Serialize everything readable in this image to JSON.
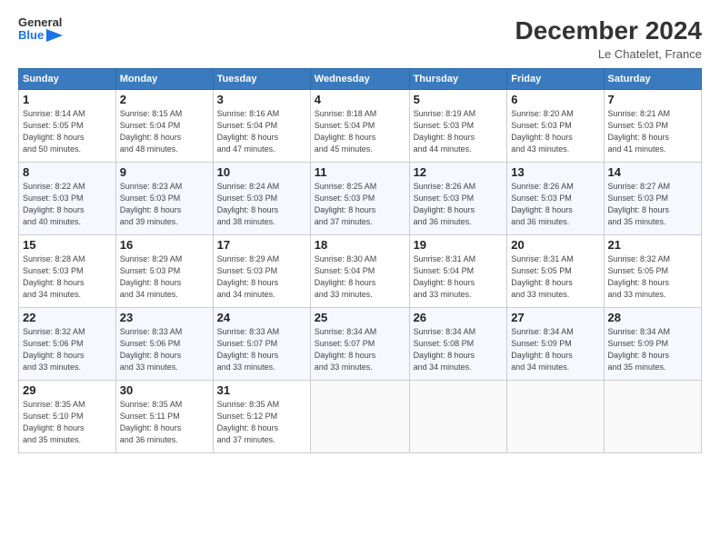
{
  "header": {
    "logo_line1": "General",
    "logo_line2": "Blue",
    "month": "December 2024",
    "location": "Le Chatelet, France"
  },
  "weekdays": [
    "Sunday",
    "Monday",
    "Tuesday",
    "Wednesday",
    "Thursday",
    "Friday",
    "Saturday"
  ],
  "weeks": [
    [
      {
        "day": "1",
        "detail": "Sunrise: 8:14 AM\nSunset: 5:05 PM\nDaylight: 8 hours\nand 50 minutes."
      },
      {
        "day": "2",
        "detail": "Sunrise: 8:15 AM\nSunset: 5:04 PM\nDaylight: 8 hours\nand 48 minutes."
      },
      {
        "day": "3",
        "detail": "Sunrise: 8:16 AM\nSunset: 5:04 PM\nDaylight: 8 hours\nand 47 minutes."
      },
      {
        "day": "4",
        "detail": "Sunrise: 8:18 AM\nSunset: 5:04 PM\nDaylight: 8 hours\nand 45 minutes."
      },
      {
        "day": "5",
        "detail": "Sunrise: 8:19 AM\nSunset: 5:03 PM\nDaylight: 8 hours\nand 44 minutes."
      },
      {
        "day": "6",
        "detail": "Sunrise: 8:20 AM\nSunset: 5:03 PM\nDaylight: 8 hours\nand 43 minutes."
      },
      {
        "day": "7",
        "detail": "Sunrise: 8:21 AM\nSunset: 5:03 PM\nDaylight: 8 hours\nand 41 minutes."
      }
    ],
    [
      {
        "day": "8",
        "detail": "Sunrise: 8:22 AM\nSunset: 5:03 PM\nDaylight: 8 hours\nand 40 minutes."
      },
      {
        "day": "9",
        "detail": "Sunrise: 8:23 AM\nSunset: 5:03 PM\nDaylight: 8 hours\nand 39 minutes."
      },
      {
        "day": "10",
        "detail": "Sunrise: 8:24 AM\nSunset: 5:03 PM\nDaylight: 8 hours\nand 38 minutes."
      },
      {
        "day": "11",
        "detail": "Sunrise: 8:25 AM\nSunset: 5:03 PM\nDaylight: 8 hours\nand 37 minutes."
      },
      {
        "day": "12",
        "detail": "Sunrise: 8:26 AM\nSunset: 5:03 PM\nDaylight: 8 hours\nand 36 minutes."
      },
      {
        "day": "13",
        "detail": "Sunrise: 8:26 AM\nSunset: 5:03 PM\nDaylight: 8 hours\nand 36 minutes."
      },
      {
        "day": "14",
        "detail": "Sunrise: 8:27 AM\nSunset: 5:03 PM\nDaylight: 8 hours\nand 35 minutes."
      }
    ],
    [
      {
        "day": "15",
        "detail": "Sunrise: 8:28 AM\nSunset: 5:03 PM\nDaylight: 8 hours\nand 34 minutes."
      },
      {
        "day": "16",
        "detail": "Sunrise: 8:29 AM\nSunset: 5:03 PM\nDaylight: 8 hours\nand 34 minutes."
      },
      {
        "day": "17",
        "detail": "Sunrise: 8:29 AM\nSunset: 5:03 PM\nDaylight: 8 hours\nand 34 minutes."
      },
      {
        "day": "18",
        "detail": "Sunrise: 8:30 AM\nSunset: 5:04 PM\nDaylight: 8 hours\nand 33 minutes."
      },
      {
        "day": "19",
        "detail": "Sunrise: 8:31 AM\nSunset: 5:04 PM\nDaylight: 8 hours\nand 33 minutes."
      },
      {
        "day": "20",
        "detail": "Sunrise: 8:31 AM\nSunset: 5:05 PM\nDaylight: 8 hours\nand 33 minutes."
      },
      {
        "day": "21",
        "detail": "Sunrise: 8:32 AM\nSunset: 5:05 PM\nDaylight: 8 hours\nand 33 minutes."
      }
    ],
    [
      {
        "day": "22",
        "detail": "Sunrise: 8:32 AM\nSunset: 5:06 PM\nDaylight: 8 hours\nand 33 minutes."
      },
      {
        "day": "23",
        "detail": "Sunrise: 8:33 AM\nSunset: 5:06 PM\nDaylight: 8 hours\nand 33 minutes."
      },
      {
        "day": "24",
        "detail": "Sunrise: 8:33 AM\nSunset: 5:07 PM\nDaylight: 8 hours\nand 33 minutes."
      },
      {
        "day": "25",
        "detail": "Sunrise: 8:34 AM\nSunset: 5:07 PM\nDaylight: 8 hours\nand 33 minutes."
      },
      {
        "day": "26",
        "detail": "Sunrise: 8:34 AM\nSunset: 5:08 PM\nDaylight: 8 hours\nand 34 minutes."
      },
      {
        "day": "27",
        "detail": "Sunrise: 8:34 AM\nSunset: 5:09 PM\nDaylight: 8 hours\nand 34 minutes."
      },
      {
        "day": "28",
        "detail": "Sunrise: 8:34 AM\nSunset: 5:09 PM\nDaylight: 8 hours\nand 35 minutes."
      }
    ],
    [
      {
        "day": "29",
        "detail": "Sunrise: 8:35 AM\nSunset: 5:10 PM\nDaylight: 8 hours\nand 35 minutes."
      },
      {
        "day": "30",
        "detail": "Sunrise: 8:35 AM\nSunset: 5:11 PM\nDaylight: 8 hours\nand 36 minutes."
      },
      {
        "day": "31",
        "detail": "Sunrise: 8:35 AM\nSunset: 5:12 PM\nDaylight: 8 hours\nand 37 minutes."
      },
      {
        "day": "",
        "detail": ""
      },
      {
        "day": "",
        "detail": ""
      },
      {
        "day": "",
        "detail": ""
      },
      {
        "day": "",
        "detail": ""
      }
    ]
  ]
}
